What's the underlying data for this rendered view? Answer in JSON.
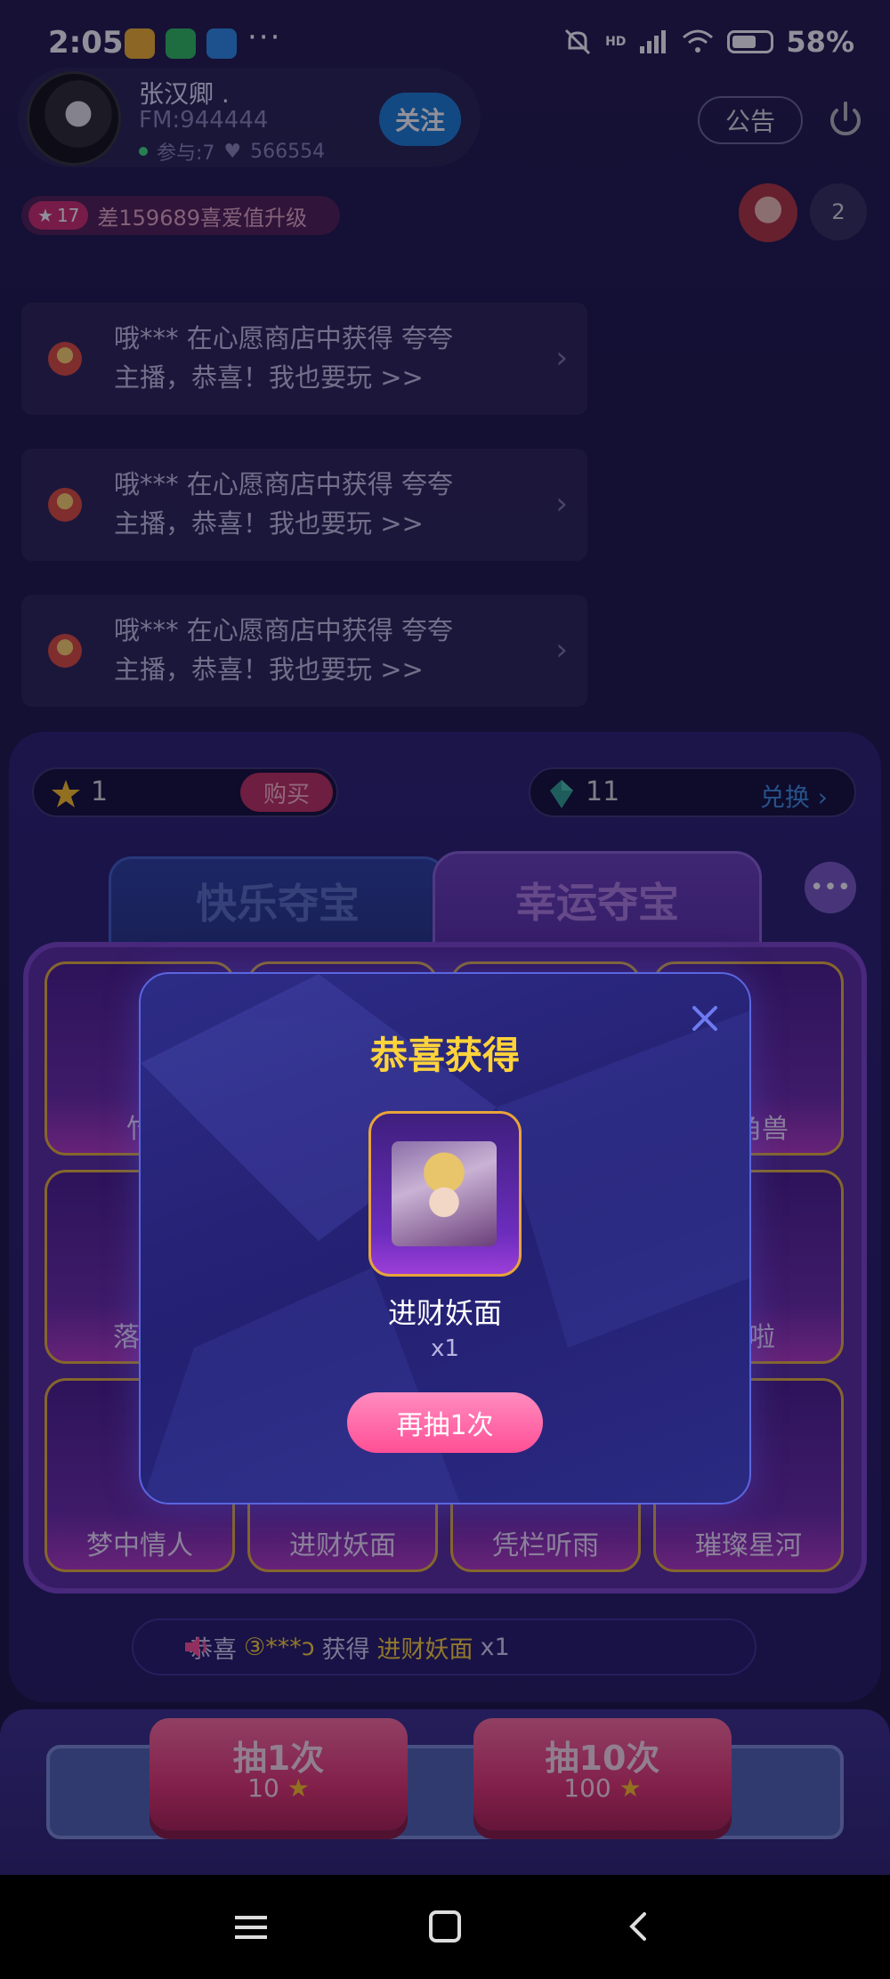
{
  "status_bar": {
    "time": "2:05",
    "battery": "58%",
    "network": "HD"
  },
  "host": {
    "name": "张汉卿 .",
    "fm": "FM:944444",
    "participants": "参与:7",
    "likes": "566554",
    "follow_label": "关注"
  },
  "header": {
    "notice_label": "公告",
    "viewer_count": "2"
  },
  "level": {
    "badge": "17",
    "text": "差159689喜爱值升级"
  },
  "messages": [
    {
      "line1": "哦*** 在心愿商店中获得 夸夸",
      "line2": "主播，恭喜！我也要玩 >>"
    },
    {
      "line1": "哦*** 在心愿商店中获得 夸夸",
      "line2": "主播，恭喜！我也要玩 >>"
    },
    {
      "line1": "哦*** 在心愿商店中获得 夸夸",
      "line2": "主播，恭喜！我也要玩 >>"
    }
  ],
  "wallet": {
    "stars": "1",
    "buy_label": "购买",
    "gems": "11",
    "exchange_label": "兑换"
  },
  "tabs": [
    {
      "label": "快乐夺宝"
    },
    {
      "label": "幸运夺宝"
    }
  ],
  "more_label": "•••",
  "prizes": [
    {
      "label": "竹"
    },
    {
      "label": ""
    },
    {
      "label": ""
    },
    {
      "label": "独角兽"
    },
    {
      "label": "落日"
    },
    {
      "label": ""
    },
    {
      "label": ""
    },
    {
      "label": "话啦"
    },
    {
      "label": "梦中情人"
    },
    {
      "label": "进财妖面"
    },
    {
      "label": "凭栏听雨"
    },
    {
      "label": "璀璨星河"
    }
  ],
  "ticker": {
    "prefix": "恭喜",
    "user": "③***ↄ",
    "mid": "获得",
    "item": "进财妖面",
    "qty": "x1"
  },
  "draw_buttons": [
    {
      "label": "抽1次",
      "cost": "10"
    },
    {
      "label": "抽10次",
      "cost": "100"
    }
  ],
  "modal": {
    "title": "恭喜获得",
    "item_name": "进财妖面",
    "qty": "x1",
    "again_label": "再抽1次"
  },
  "colors": {
    "accent_yellow": "#ffd33a",
    "pink_button": "#ff4f95",
    "follow_blue": "#1a7fd4"
  }
}
